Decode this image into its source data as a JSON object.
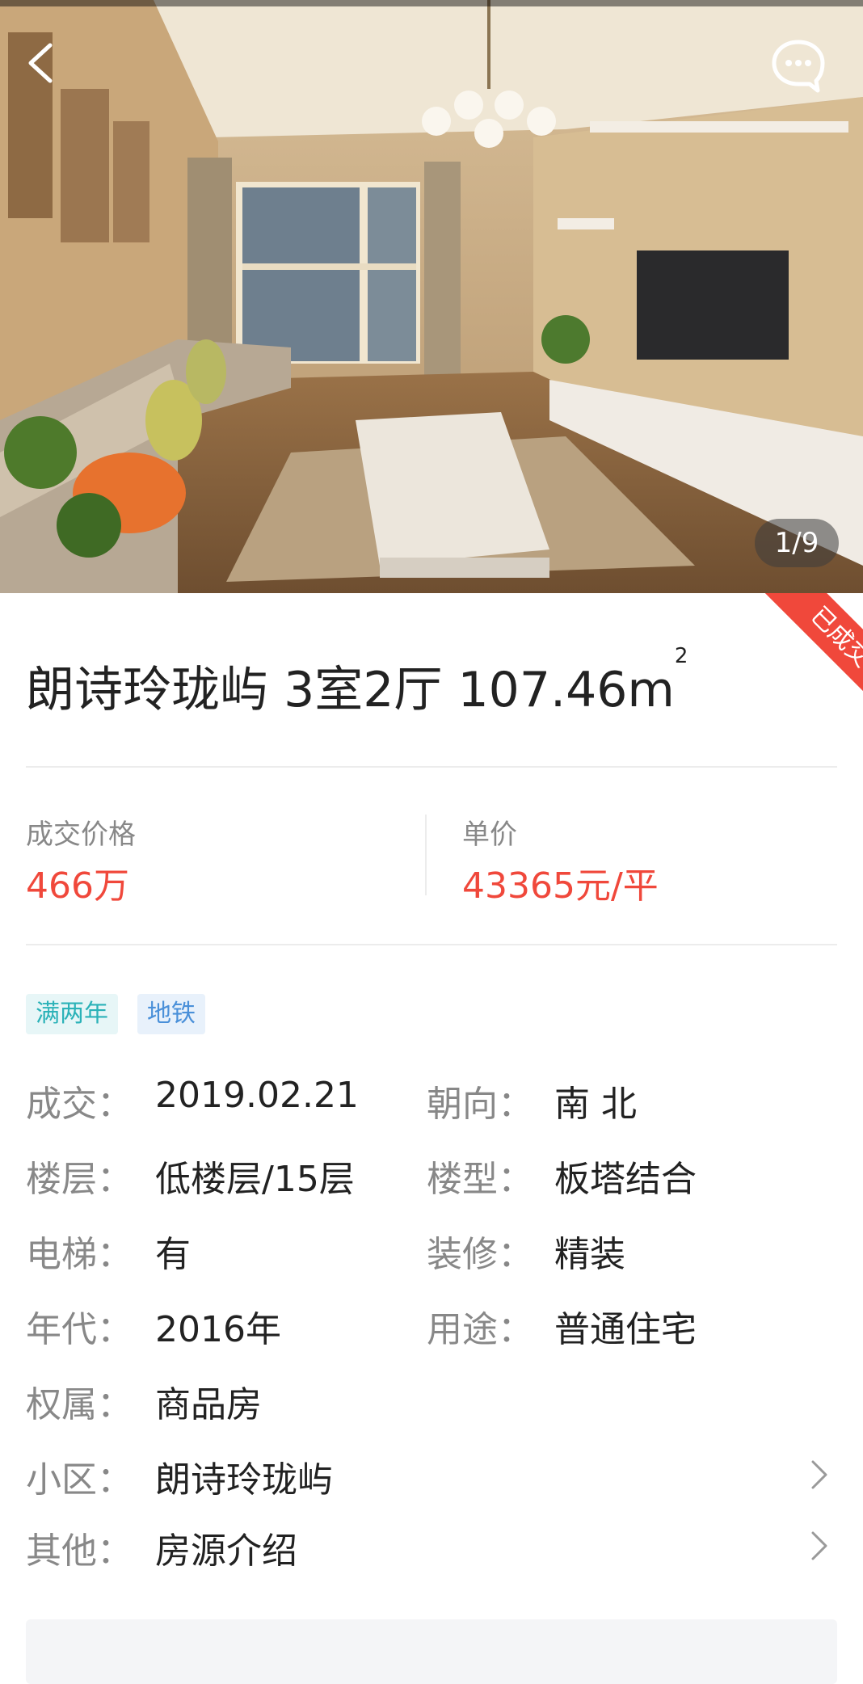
{
  "gallery": {
    "counter": "1/9",
    "status_ribbon": "已成交"
  },
  "listing": {
    "title": "朗诗玲珑屿 3室2厅 107.46m",
    "area_superscript": "2"
  },
  "price": {
    "deal_label": "成交价格",
    "deal_value": "466万",
    "unit_label": "单价",
    "unit_value": "43365元/平"
  },
  "tags": [
    "满两年",
    "地铁"
  ],
  "details": {
    "deal_label": "成交：",
    "deal_value": "2019.02.21",
    "orientation_label": "朝向：",
    "orientation_value": "南 北",
    "floor_label": "楼层：",
    "floor_value": "低楼层/15层",
    "type_label": "楼型：",
    "type_value": "板塔结合",
    "elevator_label": "电梯：",
    "elevator_value": "有",
    "decoration_label": "装修：",
    "decoration_value": "精装",
    "year_label": "年代：",
    "year_value": "2016年",
    "usage_label": "用途：",
    "usage_value": "普通住宅",
    "ownership_label": "权属：",
    "ownership_value": "商品房",
    "community_label": "小区：",
    "community_value": "朗诗玲珑屿",
    "other_label": "其他：",
    "other_value": "房源介绍"
  },
  "colors": {
    "accent": "#f0483b",
    "tag_green": "#2bb2b8",
    "tag_blue": "#4a90d9"
  },
  "icons": {
    "back": "chevron-left-icon",
    "message": "chat-bubble-icon",
    "chevron": "chevron-right-icon"
  }
}
